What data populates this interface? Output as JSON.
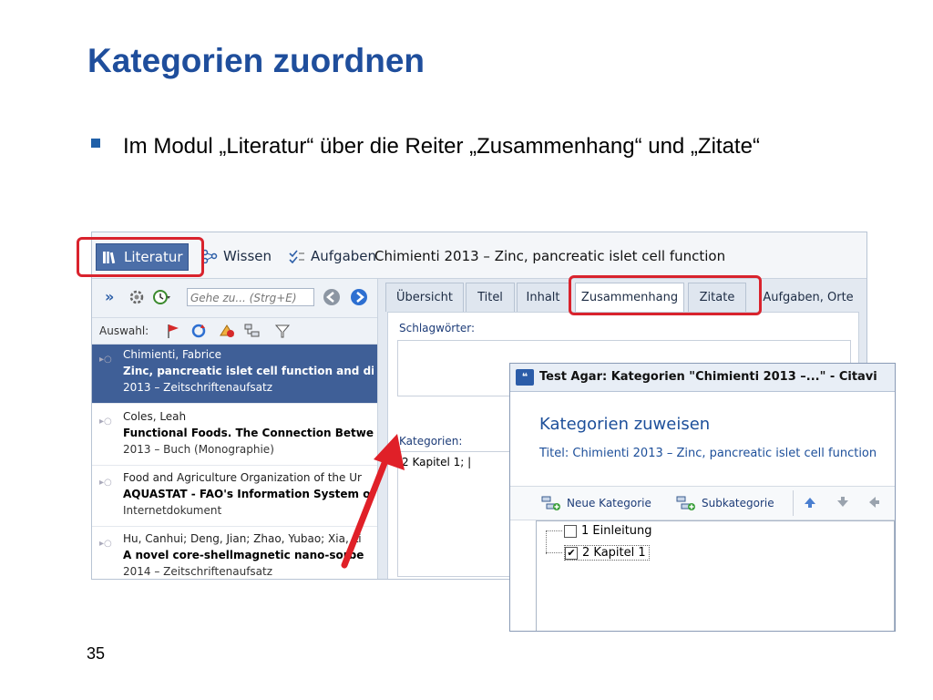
{
  "slide": {
    "title": "Kategorien zuordnen",
    "bullet": "Im Modul „Literatur“ über die Reiter „Zusammenhang“ und „Zitate“",
    "page_number": "35"
  },
  "app": {
    "toolbar": {
      "literatur": "Literatur",
      "wissen": "Wissen",
      "aufgaben": "Aufgaben",
      "doc_title": "Chimienti 2013 – Zinc, pancreatic islet cell function"
    },
    "search": {
      "placeholder": "Gehe zu... (Strg+E)",
      "nav": "»"
    },
    "selection_label": "Auswahl:",
    "references": [
      {
        "authors": "Chimienti, Fabrice",
        "title": "Zinc, pancreatic islet cell function and di",
        "meta": "2013 – Zeitschriftenaufsatz"
      },
      {
        "authors": "Coles, Leah",
        "title": "Functional Foods. The Connection Betwe",
        "meta": "2013 – Buch (Monographie)"
      },
      {
        "authors": "Food and Agriculture Organization of the Ur",
        "title": "AQUASTAT - FAO's Information System o",
        "meta": "Internetdokument"
      },
      {
        "authors": "Hu, Canhui; Deng, Jian; Zhao, Yubao; Xia, Li",
        "title": "A novel core-shellmagnetic nano-sorbe",
        "meta": "2014 – Zeitschriftenaufsatz"
      }
    ],
    "tabs": [
      "Übersicht",
      "Titel",
      "Inhalt",
      "Zusammenhang",
      "Zitate",
      "Aufgaben, Orte"
    ],
    "keywords_label": "Schlagwörter:",
    "categories_label": "Kategorien:",
    "categories_value": "2 Kapitel 1; |"
  },
  "dialog": {
    "window_title": "Test Agar: Kategorien \"Chimienti 2013 –...\" - Citavi",
    "heading": "Kategorien zuweisen",
    "subtitle": "Titel: Chimienti 2013 – Zinc, pancreatic islet cell function",
    "new_category": "Neue Kategorie",
    "subcategory": "Subkategorie",
    "tree": [
      {
        "label": "1 Einleitung",
        "checked": false
      },
      {
        "label": "2 Kapitel 1",
        "checked": true
      }
    ]
  },
  "colors": {
    "title_blue": "#1f4e9c",
    "highlight_red": "#d9232d",
    "selected_row": "#3f5f97"
  }
}
